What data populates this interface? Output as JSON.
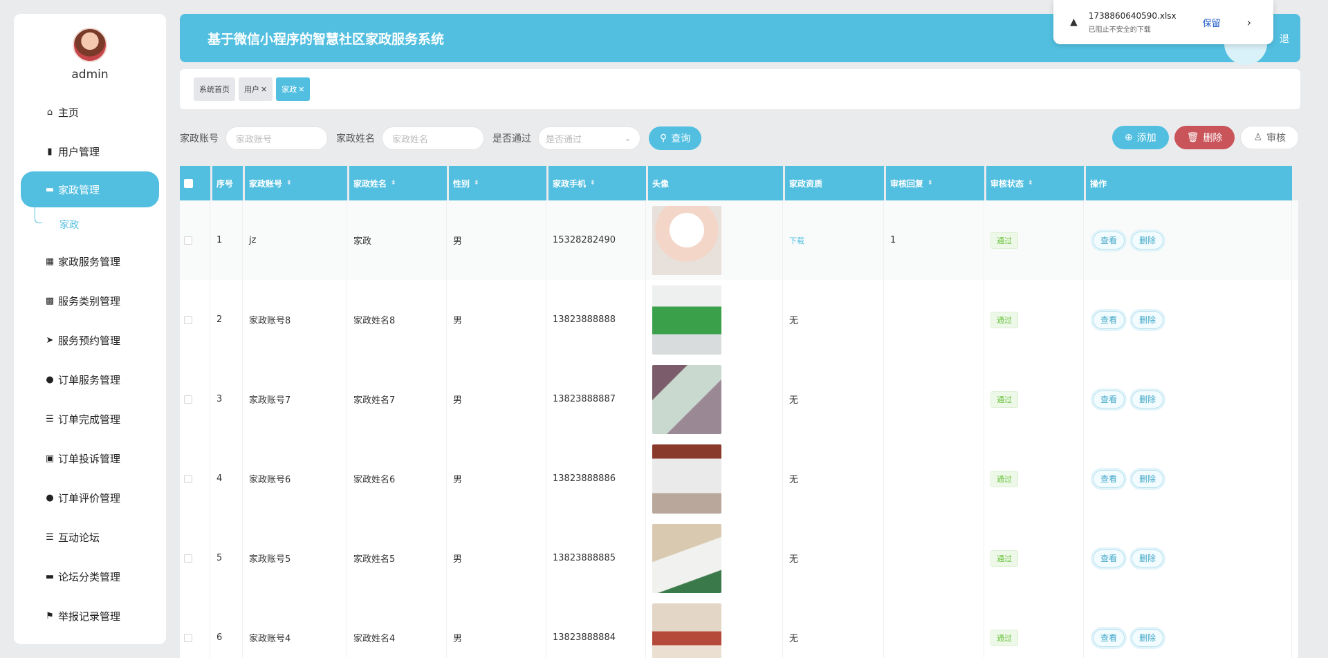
{
  "sidebar": {
    "username": "admin",
    "items": [
      {
        "label": "主页",
        "icon": "home-icon"
      },
      {
        "label": "用户管理",
        "icon": "bar-chart-icon"
      },
      {
        "label": "家政管理",
        "icon": "comment-icon",
        "active": true
      },
      {
        "label": "家政服务管理",
        "icon": "grid-icon"
      },
      {
        "label": "服务类别管理",
        "icon": "grid-nine-icon"
      },
      {
        "label": "服务预约管理",
        "icon": "send-icon"
      },
      {
        "label": "订单服务管理",
        "icon": "user-icon"
      },
      {
        "label": "订单完成管理",
        "icon": "list-icon"
      },
      {
        "label": "订单投诉管理",
        "icon": "clipboard-icon"
      },
      {
        "label": "订单评价管理",
        "icon": "bulb-icon"
      },
      {
        "label": "互动论坛",
        "icon": "list-icon"
      },
      {
        "label": "论坛分类管理",
        "icon": "monitor-icon"
      },
      {
        "label": "举报记录管理",
        "icon": "flag-icon"
      }
    ],
    "submenu": "家政"
  },
  "header": {
    "title": "基于微信小程序的智慧社区家政服务系统",
    "right_text": "退"
  },
  "tags": [
    {
      "label": "系统首页",
      "closable": false
    },
    {
      "label": "用户",
      "closable": true
    },
    {
      "label": "家政",
      "closable": true,
      "active": true
    }
  ],
  "search": {
    "account_label": "家政账号",
    "account_placeholder": "家政账号",
    "name_label": "家政姓名",
    "name_placeholder": "家政姓名",
    "pass_label": "是否通过",
    "pass_placeholder": "是否通过",
    "search_button": "查询"
  },
  "actions": {
    "add": "添加",
    "delete": "删除",
    "audit": "审核"
  },
  "table": {
    "columns": [
      "序号",
      "家政账号",
      "家政姓名",
      "性别",
      "家政手机",
      "头像",
      "家政资质",
      "审核回复",
      "审核状态",
      "操作"
    ],
    "rows": [
      {
        "no": "1",
        "account": "jz",
        "name": "家政",
        "gender": "男",
        "phone": "15328282490",
        "qual": "下载",
        "reply": "1",
        "status": "通过"
      },
      {
        "no": "2",
        "account": "家政账号8",
        "name": "家政姓名8",
        "gender": "男",
        "phone": "13823888888",
        "qual": "无",
        "reply": "",
        "status": "通过"
      },
      {
        "no": "3",
        "account": "家政账号7",
        "name": "家政姓名7",
        "gender": "男",
        "phone": "13823888887",
        "qual": "无",
        "reply": "",
        "status": "通过"
      },
      {
        "no": "4",
        "account": "家政账号6",
        "name": "家政姓名6",
        "gender": "男",
        "phone": "13823888886",
        "qual": "无",
        "reply": "",
        "status": "通过"
      },
      {
        "no": "5",
        "account": "家政账号5",
        "name": "家政姓名5",
        "gender": "男",
        "phone": "13823888885",
        "qual": "无",
        "reply": "",
        "status": "通过"
      },
      {
        "no": "6",
        "account": "家政账号4",
        "name": "家政姓名4",
        "gender": "男",
        "phone": "13823888884",
        "qual": "无",
        "reply": "",
        "status": "通过"
      }
    ],
    "view_label": "查看",
    "delete_label": "删除"
  },
  "download": {
    "filename": "1738860640590.xlsx",
    "message": "已阻止不安全的下载",
    "keep": "保留"
  },
  "colors": {
    "accent": "#52bfe0",
    "danger": "#c9545a",
    "success": "#67c23a"
  }
}
